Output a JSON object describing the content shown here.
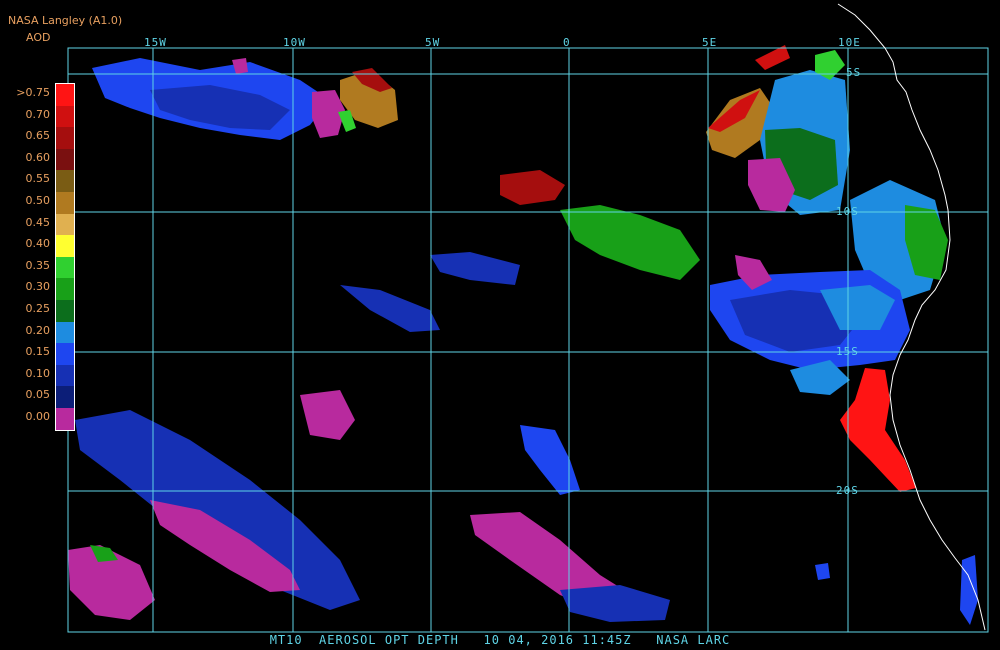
{
  "header": {
    "producer": "NASA Langley (A1.0)",
    "unit": "AOD"
  },
  "colorbar": {
    "labels": [
      ">0.75",
      "0.70",
      "0.65",
      "0.60",
      "0.55",
      "0.50",
      "0.45",
      "0.40",
      "0.35",
      "0.30",
      "0.25",
      "0.20",
      "0.15",
      "0.10",
      "0.05",
      "0.00"
    ],
    "colors": [
      "#ff1414",
      "#d01010",
      "#a50e0e",
      "#7a1010",
      "#7a5c14",
      "#b07a20",
      "#e0b050",
      "#ffff30",
      "#30d030",
      "#18a018",
      "#0c6e1c",
      "#1e8ce0",
      "#1e46f0",
      "#1630b4",
      "#0c1e78",
      "#b82a9e"
    ]
  },
  "longitude_labels": [
    "15W",
    "10W",
    "5W",
    "0",
    "5E",
    "10E"
  ],
  "latitude_labels": [
    "5S",
    "10S",
    "15S",
    "20S"
  ],
  "footer": {
    "text": "MT10  AEROSOL OPT DEPTH   10 04, 2016 11:45Z   NASA LARC"
  },
  "colors": {
    "grid": "#5fd4e6",
    "coastline": "#ffffff",
    "label": "#e8a060"
  }
}
